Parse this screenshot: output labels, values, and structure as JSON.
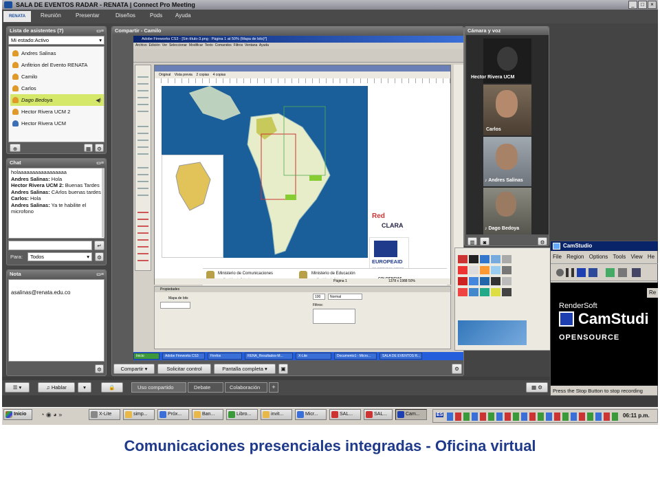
{
  "window": {
    "title": "SALA DE EVENTOS RADAR - RENATA | Connect Pro Meeting",
    "controls": [
      "_",
      "□",
      "×"
    ]
  },
  "menubar": {
    "logo": "RENATA",
    "items": [
      "Reunión",
      "Presentar",
      "Diseños",
      "Pods",
      "Ayuda"
    ]
  },
  "attendees": {
    "title": "Lista de asistentes (7)",
    "status": "Mi estado:Activo",
    "list": [
      {
        "name": "Andres Salinas",
        "icon": "presenter-icon"
      },
      {
        "name": "Anfitrion del Evento RENATA",
        "icon": "presenter-icon"
      },
      {
        "name": "Camilo",
        "icon": "presenter-icon"
      },
      {
        "name": "Carlos",
        "icon": "presenter-icon"
      },
      {
        "name": "Dago Bedoya",
        "icon": "presenter-icon",
        "speaking": true
      },
      {
        "name": "Hector Rivera UCM 2",
        "icon": "presenter-icon"
      },
      {
        "name": "Hector Rivera UCM",
        "icon": "participant-icon"
      }
    ]
  },
  "chat": {
    "title": "Chat",
    "messages": [
      {
        "sender": "",
        "text": "holaaaaaaaaaaaaaaaaa"
      },
      {
        "sender": "Andres Salinas:",
        "text": "Hola"
      },
      {
        "sender": "Hector Rivera UCM 2:",
        "text": "Buenas Tardes"
      },
      {
        "sender": "Andres Salinas:",
        "text": "CArlos buenas tardes"
      },
      {
        "sender": "Carlos:",
        "text": "Hola"
      },
      {
        "sender": "Andres Salinas:",
        "text": "Ya te habilite el microfono"
      }
    ],
    "to_label": "Para:",
    "to_value": "Todos"
  },
  "note": {
    "title": "Nota",
    "text": "asalinas@renata.edu.co"
  },
  "share": {
    "title": "Compartir - Camilo",
    "buttons": [
      "Compartir",
      "Solicitar control",
      "Pantalla completa"
    ],
    "fireworks": {
      "title": "Adobe Fireworks CS3 - [Sin título-3.png : Página 1 at 50% (Mapa de bits)*]",
      "menus": [
        "Archivo",
        "Edición",
        "Ver",
        "Seleccionar",
        "Modificar",
        "Texto",
        "Comandos",
        "Filtros",
        "Ventana",
        "Ayuda"
      ],
      "doc_tabs": [
        "Original",
        "Vista previa",
        "2 copias",
        "4 copias"
      ],
      "map_labels": [
        "Red",
        "CLARA",
        "EUROPEAID",
        "CO-OPERATION OFFICE"
      ],
      "footer": [
        "Ministerio de Comunicaciones",
        "República de Colombia",
        "Ministerio de Educación",
        "República de Colombia",
        "COLCIENCIAS"
      ],
      "status_left": "Página 1",
      "status_right": "1378 x 1988  50%",
      "props_title": "Propiedades",
      "props_label": "Mapa de bits",
      "props_blend": "Normal",
      "props_opacity": "100",
      "props_filters": "Filtros:",
      "taskbar": [
        "Inicio",
        "Adobe Fireworks CS3",
        "Firefox",
        "RENA_Resultados-M...",
        "X-Lite",
        "Documento1 - Micro...",
        "SALA DE EVENTOS R..."
      ]
    }
  },
  "camera": {
    "title": "Cámara y voz",
    "feeds": [
      "Hector Rivera UCM",
      "Carlos",
      "Andres Salinas",
      "Dago Bedoya"
    ]
  },
  "bottom_bar": {
    "talk": "Hablar",
    "tabs": [
      "Uso compartido",
      "Debate",
      "Colaboración"
    ],
    "add": "+"
  },
  "camstudio": {
    "title": "CamStudio",
    "menus": [
      "File",
      "Region",
      "Options",
      "Tools",
      "View",
      "He"
    ],
    "brand_small": "RenderSoft",
    "brand_big": "CamStudi",
    "brand_sub": "OPENSOURCE",
    "status": "Press the Stop Button to stop recording",
    "re_badge": "Re"
  },
  "taskbar": {
    "start": "Inicio",
    "items": [
      "X-Lite",
      "simp...",
      "Próx...",
      "Ban...",
      "Libro...",
      "invit...",
      "Micr...",
      "SAL...",
      "SAL...",
      "Cam..."
    ],
    "lang": "ES",
    "clock": "06:11 p.m."
  },
  "caption": "Comunicaciones presenciales integradas - Oficina virtual",
  "colors": {
    "accent_blue": "#1f3a8a",
    "xp_taskbar": "#d4d0c8",
    "camstudio_bar": "#0a246a"
  }
}
